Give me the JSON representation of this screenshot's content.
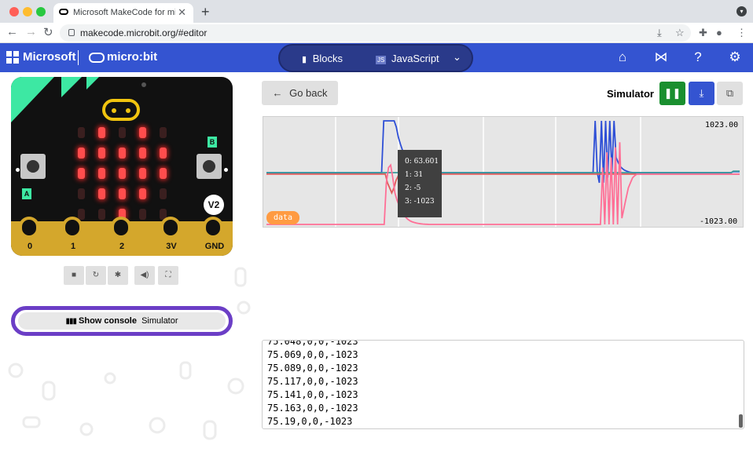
{
  "browser": {
    "tab_title": "Microsoft MakeCode for mi",
    "url": "makecode.microbit.org/#editor",
    "traffic_colors": [
      "#ff5f57",
      "#febc2e",
      "#28c840"
    ]
  },
  "header": {
    "brand": "Microsoft",
    "product": "micro:bit",
    "toggle": {
      "blocks_label": "Blocks",
      "javascript_label": "JavaScript"
    },
    "icons": [
      "home-icon",
      "share-icon",
      "help-icon",
      "settings-icon"
    ],
    "bg_color": "#3454d1"
  },
  "simulator": {
    "board_version": "V2",
    "button_a": "A",
    "button_b": "B",
    "pins": [
      "0",
      "1",
      "2",
      "3V",
      "GND"
    ],
    "led_matrix": [
      [
        0,
        1,
        0,
        1,
        0
      ],
      [
        1,
        1,
        1,
        1,
        1
      ],
      [
        1,
        1,
        1,
        1,
        1
      ],
      [
        0,
        1,
        1,
        1,
        0
      ],
      [
        0,
        0,
        1,
        0,
        0
      ]
    ],
    "toolbar_icons": [
      "stop-icon",
      "restart-icon",
      "debug-icon",
      "mute-icon",
      "fullscreen-icon"
    ],
    "show_console_label": "Show console",
    "show_console_source": "Simulator"
  },
  "console_panel": {
    "go_back_label": "Go back",
    "title": "Simulator",
    "pause_color": "#1a8f2f",
    "download_color": "#3454d1"
  },
  "chart_data": {
    "type": "line",
    "y_max_label": "1023.00",
    "y_min_label": "-1023.00",
    "ylim": [
      -1023,
      1023
    ],
    "badge": "data",
    "tooltip": [
      "0: 63.601",
      "1: 31",
      "2: -5",
      "3: -1023"
    ],
    "series": [
      {
        "color": "#2e4fd6",
        "values": [
          0,
          0,
          0,
          0,
          0,
          0,
          0,
          0,
          0,
          0,
          0,
          0,
          0,
          0,
          0,
          0,
          0,
          0,
          0,
          0,
          0,
          0,
          0,
          0,
          0,
          0,
          0,
          0,
          0,
          0,
          0,
          0,
          0,
          0,
          0,
          0,
          0,
          0,
          0,
          0,
          0,
          0,
          0,
          0,
          0,
          0,
          0,
          0,
          0,
          0,
          0,
          0,
          0,
          0,
          0,
          0,
          1023,
          1023,
          1023,
          1023,
          1023,
          1023,
          900,
          700,
          560,
          440,
          350,
          280,
          220,
          170,
          130,
          100,
          80,
          60,
          45,
          35,
          25,
          20,
          15,
          10,
          5,
          3,
          2,
          0,
          0,
          0,
          0,
          0,
          0,
          0,
          0,
          0,
          0,
          0,
          0,
          0,
          0,
          0,
          0,
          0,
          0,
          0,
          0,
          0,
          0,
          0,
          0,
          0,
          0,
          0,
          0,
          0,
          0,
          0,
          0,
          0,
          0,
          0,
          0,
          0,
          0,
          0,
          0,
          0,
          0,
          0,
          0,
          0,
          0,
          0,
          0,
          0,
          0,
          0,
          0,
          0,
          0,
          0,
          0,
          0,
          0,
          0,
          0,
          0,
          0,
          0,
          0,
          0,
          0,
          0,
          0,
          0,
          0,
          0,
          0,
          0,
          0,
          1023,
          0,
          -200,
          1023,
          -200,
          1023,
          -100,
          1023,
          0,
          1023,
          300,
          200,
          120,
          80,
          50,
          30,
          15,
          5,
          0,
          0,
          0,
          0,
          0,
          0,
          0,
          0,
          0,
          0,
          0,
          0,
          0,
          0,
          0,
          0,
          0,
          0,
          0,
          0,
          0,
          0,
          0,
          0,
          0,
          0,
          0,
          0,
          0,
          0,
          0,
          0,
          0,
          0,
          0,
          0,
          0,
          0,
          0,
          0,
          0,
          0,
          0,
          0,
          0,
          0,
          0,
          0,
          20,
          20,
          20,
          20
        ]
      },
      {
        "color": "#3a9a9a",
        "values": [
          0,
          0,
          0,
          0,
          0,
          0,
          0,
          0,
          0,
          0,
          0,
          0,
          0,
          0,
          0,
          0,
          0,
          0,
          0,
          0,
          0,
          0,
          0,
          0,
          0,
          0,
          0,
          0,
          0,
          0,
          0,
          0,
          0,
          0,
          0,
          0,
          0,
          0,
          0,
          0,
          0,
          0,
          0,
          0,
          0,
          0,
          0,
          0,
          0,
          0,
          0,
          0,
          0,
          0,
          0,
          0,
          0,
          0,
          0,
          0,
          0,
          0,
          0,
          0,
          0,
          0,
          0,
          0,
          0,
          0,
          0,
          0,
          0,
          0,
          0,
          0,
          0,
          0,
          0,
          0,
          0,
          0,
          0,
          0,
          0,
          0,
          0,
          0,
          0,
          0,
          0,
          0,
          0,
          0,
          0,
          0,
          0,
          0,
          0,
          0,
          0,
          0,
          0,
          0,
          0,
          0,
          0,
          0,
          0,
          0,
          0,
          0,
          0,
          0,
          0,
          0,
          0,
          0,
          0,
          0,
          0,
          0,
          0,
          0,
          0,
          0,
          0,
          0,
          0,
          0,
          0,
          0,
          0,
          0,
          0,
          0,
          0,
          0,
          0,
          0,
          0,
          0,
          0,
          0,
          0,
          0,
          0,
          0,
          0,
          0,
          0,
          0,
          0,
          0,
          0,
          0,
          0,
          0,
          0,
          0,
          0,
          0,
          0,
          0,
          0,
          0,
          0,
          0,
          0,
          0,
          0,
          0,
          0,
          0,
          0,
          0,
          0,
          0,
          0,
          0,
          0,
          0,
          0,
          0,
          0,
          0,
          0,
          0,
          0,
          0,
          0,
          0,
          0,
          0,
          0,
          0,
          0,
          0,
          0,
          0,
          0,
          0,
          0,
          0,
          0,
          0,
          0,
          0,
          0,
          0,
          0,
          0,
          0,
          0,
          0,
          0,
          0,
          0,
          0,
          0,
          0,
          0,
          30,
          30,
          30,
          30
        ]
      },
      {
        "color": "#e05b5b",
        "values": [
          -30,
          -30,
          -30,
          -30,
          -30,
          -30,
          -30,
          -30,
          -30,
          -30,
          -30,
          -30,
          -30,
          -30,
          -30,
          -30,
          -30,
          -30,
          -30,
          -30,
          -30,
          -30,
          -30,
          -30,
          -30,
          -30,
          -30,
          -30,
          -30,
          -30,
          -30,
          -30,
          -30,
          -30,
          -30,
          -30,
          -30,
          -30,
          -30,
          -30,
          -30,
          -30,
          -30,
          -30,
          -30,
          -30,
          -30,
          -30,
          -30,
          -30,
          -30,
          -30,
          -30,
          -30,
          -30,
          -30,
          -200,
          -300,
          -400,
          -300,
          -150,
          -60,
          -40,
          -30,
          -30,
          -30,
          -30,
          -30,
          -30,
          -30,
          -30,
          -30,
          -30,
          -30,
          -30,
          -30,
          -30,
          -30,
          -30,
          -30,
          -30,
          -30,
          -30,
          -30,
          -30,
          -30,
          -30,
          -30,
          -30,
          -30,
          -30,
          -30,
          -30,
          -30,
          -30,
          -30,
          -30,
          -30,
          -30,
          -30,
          -30,
          -30,
          -30,
          -30,
          -30,
          -30,
          -30,
          -30,
          -30,
          -30,
          -30,
          -30,
          -30,
          -30,
          -30,
          -30,
          -30,
          -30,
          -30,
          -30,
          -30,
          -30,
          -30,
          -30,
          -30,
          -30,
          -30,
          -30,
          -30,
          -30,
          -30,
          -30,
          -30,
          -30,
          -30,
          -30,
          -30,
          -30,
          -30,
          -30,
          -30,
          -30,
          -30,
          -30,
          -30,
          -30,
          -30,
          -30,
          -30,
          -30,
          -30,
          -30,
          -30,
          -30,
          -30,
          -30,
          -30,
          -30,
          -30,
          -30,
          -30,
          -30,
          -30,
          -30,
          -30,
          -30,
          -30,
          -30,
          -30,
          -30,
          -30,
          -30,
          -30,
          -30,
          -30,
          -30,
          -30,
          -30,
          -30,
          -30,
          -30,
          -30,
          -30,
          -30,
          -30,
          -30,
          -30,
          -30,
          -30,
          -30,
          -30,
          -30,
          -30,
          -30,
          -30,
          -30,
          -30,
          -30,
          -30,
          -30,
          -30,
          -30,
          -30,
          -30,
          -30,
          -30,
          -30,
          -30,
          -30,
          -30,
          -30,
          -30,
          -30,
          -30,
          -30,
          -30,
          -30,
          -30,
          -30,
          -30
        ]
      },
      {
        "color": "#ff6f96",
        "values": [
          -1023,
          -1023,
          -1023,
          -1023,
          -1023,
          -1023,
          -1023,
          -1023,
          -1023,
          -1023,
          -1023,
          -1023,
          -1023,
          -1023,
          -1023,
          -1023,
          -1023,
          -1023,
          -1023,
          -1023,
          -1023,
          -1023,
          -1023,
          -1023,
          -1023,
          -1023,
          -1023,
          -1023,
          -1023,
          -1023,
          -1023,
          -1023,
          -1023,
          -1023,
          -1023,
          -1023,
          -1023,
          -1023,
          -1023,
          -1023,
          -1023,
          -1023,
          -1023,
          -1023,
          -1023,
          -1023,
          -1023,
          -1023,
          -1023,
          -1023,
          -1023,
          -1023,
          -1023,
          -1023,
          -1023,
          -1023,
          -200,
          100,
          150,
          -100,
          -400,
          -550,
          -650,
          -750,
          -820,
          -880,
          -920,
          -950,
          -970,
          -985,
          -995,
          -1005,
          -1010,
          -1015,
          -1018,
          -1020,
          -1023,
          -1023,
          -1023,
          -1023,
          -1023,
          -1023,
          -1023,
          -1023,
          -1023,
          -1023,
          -1023,
          -1023,
          -1023,
          -1023,
          -1023,
          -1023,
          -1023,
          -1023,
          -1023,
          -1023,
          -1023,
          -1023,
          -1023,
          -1023,
          -1023,
          -1023,
          -1023,
          -1023,
          -1023,
          -1023,
          -1023,
          -1023,
          -1023,
          -1023,
          -1023,
          -1023,
          -1023,
          -1023,
          -1023,
          -1023,
          -1023,
          -1023,
          -1023,
          -1023,
          -1023,
          -1023,
          -1023,
          -1023,
          -1023,
          -1023,
          -1023,
          -1023,
          -1023,
          -1023,
          -1023,
          -1023,
          -1023,
          -1023,
          -1023,
          -1023,
          -1023,
          -1023,
          -1023,
          -1023,
          -1023,
          -1023,
          -1023,
          -1023,
          -1023,
          -1023,
          -1023,
          -1023,
          -1023,
          -1023,
          -1023,
          -1023,
          -1023,
          -1023,
          -1023,
          -1023,
          -1023,
          100,
          -1023,
          400,
          -1023,
          300,
          -1023,
          500,
          -1023,
          600,
          -900,
          -700,
          -500,
          -300,
          -200,
          -100,
          -60,
          -30,
          -30,
          -30,
          -30,
          -30,
          -30,
          -30,
          -30,
          -30,
          -30,
          -30,
          -30,
          -30,
          -30,
          -30,
          -30,
          -30,
          -30,
          -30,
          -30,
          -30,
          -30,
          -30,
          -30,
          -30,
          -30,
          -30,
          -30,
          -30,
          -30,
          -30,
          -30,
          -30,
          -30,
          -30,
          -30,
          -30,
          -30,
          -30,
          -30,
          -30,
          -30,
          -30,
          -30,
          -30,
          -30,
          -30,
          -30,
          -30
        ]
      }
    ]
  },
  "console_lines": [
    "75.048,0,0,-1023",
    "75.069,0,0,-1023",
    "75.089,0,0,-1023",
    "75.117,0,0,-1023",
    "75.141,0,0,-1023",
    "75.163,0,0,-1023",
    "75.19,0,0,-1023"
  ]
}
